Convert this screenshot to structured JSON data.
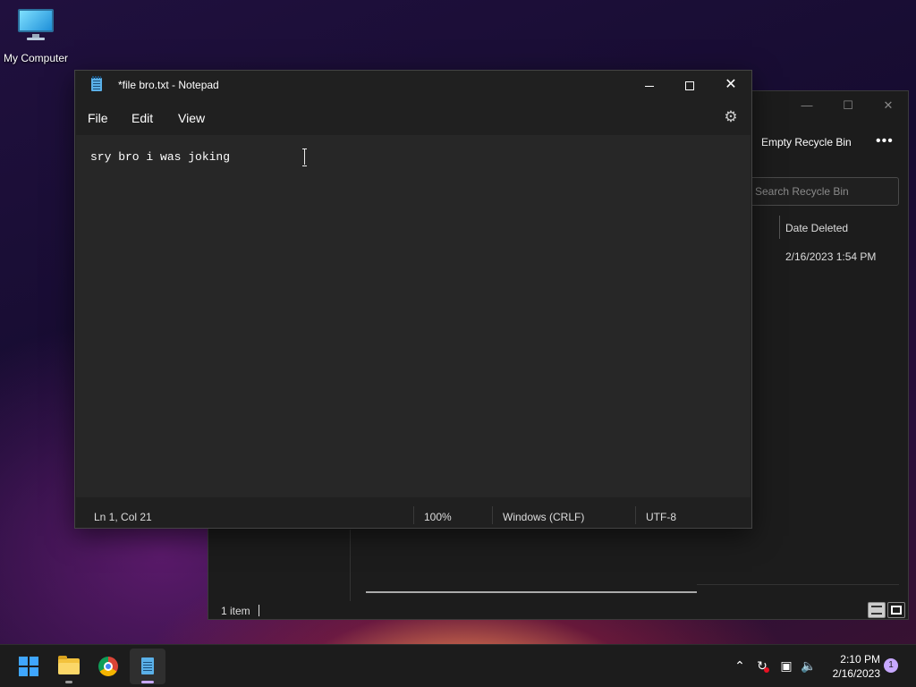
{
  "desktop": {
    "icons": [
      {
        "label": "My Computer",
        "icon": "monitor-icon"
      }
    ]
  },
  "recycle_bin": {
    "toolbar": {
      "empty_label": "Empty Recycle Bin",
      "more_label": "•••"
    },
    "search": {
      "placeholder": "Search Recycle Bin"
    },
    "columns": [
      "Date Deleted"
    ],
    "rows": [
      {
        "date_deleted": "2/16/2023 1:54 PM"
      }
    ],
    "status": {
      "item_count": "1 item"
    }
  },
  "notepad": {
    "title": "*file bro.txt - Notepad",
    "menu": [
      "File",
      "Edit",
      "View"
    ],
    "content": "sry bro i was joking",
    "status": {
      "position": "Ln 1, Col 21",
      "zoom": "100%",
      "line_ending": "Windows (CRLF)",
      "encoding": "UTF-8"
    }
  },
  "taskbar": {
    "apps": [
      {
        "name": "start",
        "icon": "windows-logo-icon"
      },
      {
        "name": "file-explorer",
        "icon": "folder-icon"
      },
      {
        "name": "chrome",
        "icon": "chrome-icon"
      },
      {
        "name": "notepad",
        "icon": "notepad-icon",
        "active": true
      }
    ],
    "tray": [
      "chevron-up-icon",
      "sync-icon",
      "network-icon",
      "volume-icon"
    ],
    "clock": {
      "time": "2:10 PM",
      "date": "2/16/2023"
    },
    "notifications": "1"
  },
  "colors": {
    "accent": "#c7a8ff",
    "window_bg": "#202020",
    "editor_bg": "#272727"
  }
}
